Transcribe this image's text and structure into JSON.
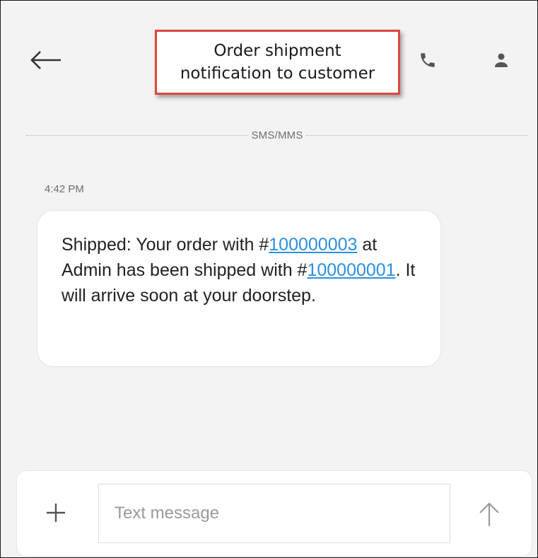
{
  "header": {
    "callout_lines": [
      "Order shipment",
      "notification to customer"
    ]
  },
  "thread": {
    "channel_label": "SMS/MMS",
    "timestamp": "4:42 PM",
    "message": {
      "text_1": "Shipped: Your order with #",
      "order_number": "100000003",
      "text_2": " at Admin has been shipped with #",
      "shipment_number": "100000001",
      "text_3": ". It will arrive soon at your doorstep."
    }
  },
  "composer": {
    "placeholder": "Text message"
  },
  "icons": {
    "back": "arrow-left-icon",
    "phone": "phone-icon",
    "contact": "person-icon",
    "add": "plus-icon",
    "send": "arrow-up-icon"
  },
  "colors": {
    "callout_border": "#d9483f",
    "link": "#2b8fe0",
    "background": "#f3f3f3"
  }
}
